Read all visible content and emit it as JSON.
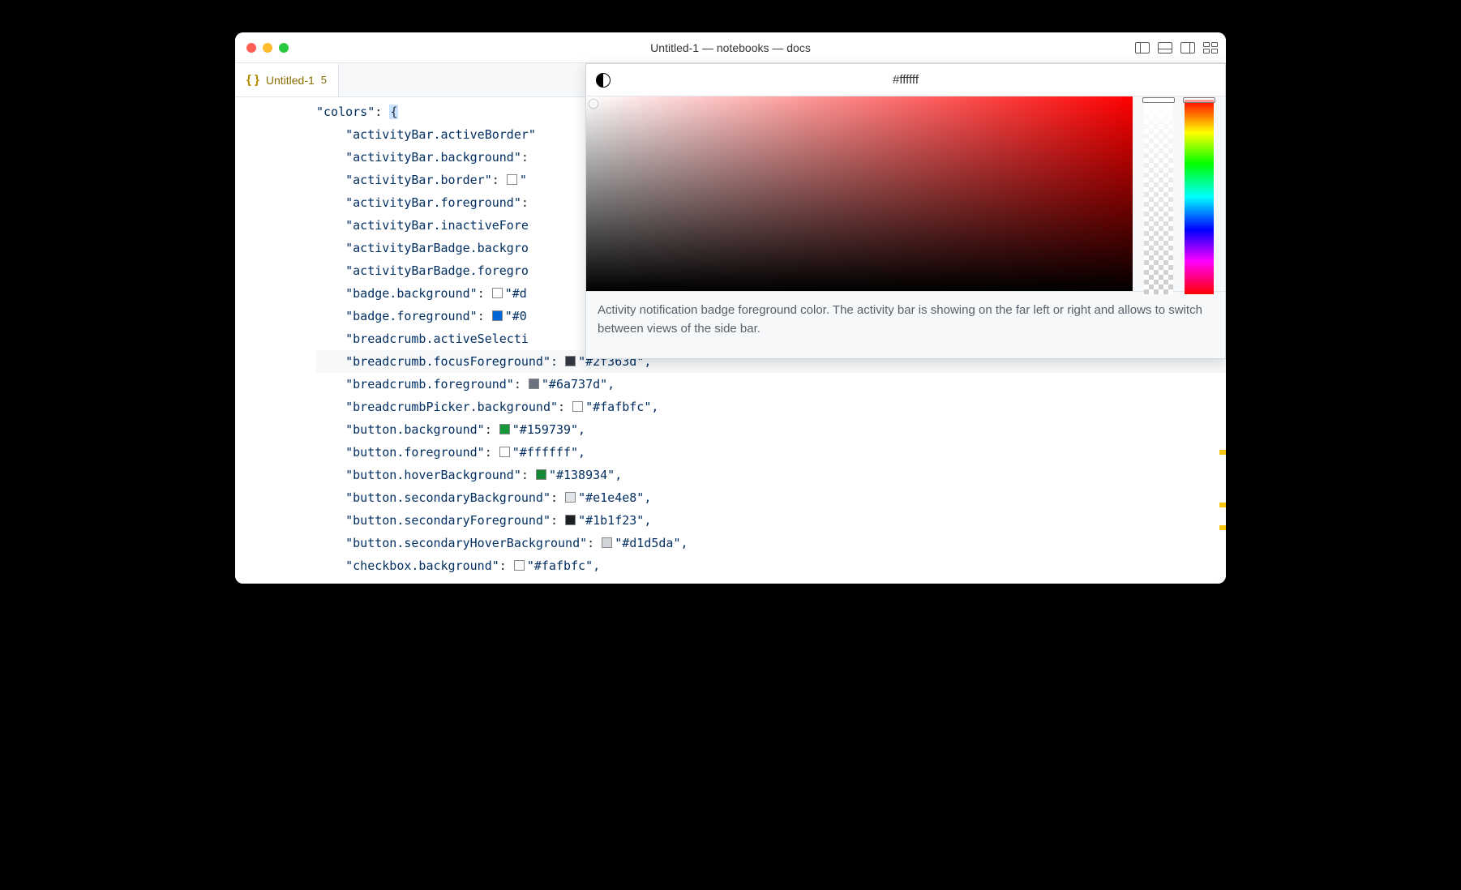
{
  "window": {
    "title": "Untitled-1 — notebooks — docs"
  },
  "tab": {
    "icon_label": "{ }",
    "name": "Untitled-1",
    "dirty_count": "5"
  },
  "picker": {
    "hex": "#ffffff",
    "description": "Activity notification badge foreground color. The activity bar is showing on the far left or right and allows to switch between views of the side bar."
  },
  "code": {
    "top_key": "\"colors\"",
    "lines": [
      {
        "key": "\"activityBar.activeBorder\""
      },
      {
        "key": "\"activityBar.background\"",
        "tail": ":"
      },
      {
        "key": "\"activityBar.border\"",
        "tail": ": ",
        "swatch": "#ffffff",
        "value": "\""
      },
      {
        "key": "\"activityBar.foreground\"",
        "tail": ":"
      },
      {
        "key": "\"activityBar.inactiveFore"
      },
      {
        "key": "\"activityBarBadge.backgro"
      },
      {
        "key": "\"activityBarBadge.foregro"
      },
      {
        "key": "\"badge.background\"",
        "tail": ": ",
        "swatch": "#ffffff",
        "value": "\"#d"
      },
      {
        "key": "\"badge.foreground\"",
        "tail": ": ",
        "swatch": "#0366d6",
        "value": "\"#0"
      },
      {
        "key": "\"breadcrumb.activeSelecti"
      },
      {
        "key": "\"breadcrumb.focusForeground\"",
        "tail": ": ",
        "swatch": "#2f363d",
        "value": "\"#2f363d\",",
        "hl": true
      },
      {
        "key": "\"breadcrumb.foreground\"",
        "tail": ": ",
        "swatch": "#6a737d",
        "value": "\"#6a737d\","
      },
      {
        "key": "\"breadcrumbPicker.background\"",
        "tail": ": ",
        "swatch": "#fafbfc",
        "value": "\"#fafbfc\","
      },
      {
        "key": "\"button.background\"",
        "tail": ": ",
        "swatch": "#159739",
        "value": "\"#159739\","
      },
      {
        "key": "\"button.foreground\"",
        "tail": ": ",
        "swatch": "#ffffff",
        "value": "\"#ffffff\","
      },
      {
        "key": "\"button.hoverBackground\"",
        "tail": ": ",
        "swatch": "#138934",
        "value": "\"#138934\","
      },
      {
        "key": "\"button.secondaryBackground\"",
        "tail": ": ",
        "swatch": "#e1e4e8",
        "value": "\"#e1e4e8\","
      },
      {
        "key": "\"button.secondaryForeground\"",
        "tail": ": ",
        "swatch": "#1b1f23",
        "value": "\"#1b1f23\","
      },
      {
        "key": "\"button.secondaryHoverBackground\"",
        "tail": ": ",
        "swatch": "#d1d5da",
        "value": "\"#d1d5da\","
      },
      {
        "key": "\"checkbox.background\"",
        "tail": ": ",
        "swatch": "#fafbfc",
        "value": "\"#fafbfc\","
      }
    ]
  }
}
